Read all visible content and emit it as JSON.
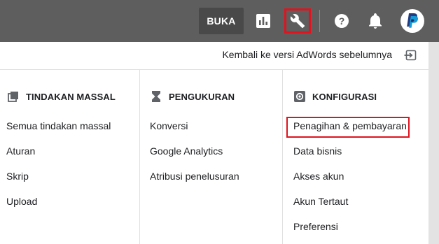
{
  "header": {
    "buka_label": "BUKA",
    "icons": [
      "reports-icon",
      "wrench-icon",
      "help-icon",
      "bell-icon",
      "paypal-avatar"
    ],
    "highlight_color": "#e0131f"
  },
  "panel": {
    "kembali_text": "Kembali ke versi AdWords sebelumnya",
    "columns": [
      {
        "heading": "TINDAKAN MASSAL",
        "icon": "bulk-actions-icon",
        "items": [
          "Semua tindakan massal",
          "Aturan",
          "Skrip",
          "Upload"
        ]
      },
      {
        "heading": "PENGUKURAN",
        "icon": "hourglass-icon",
        "items": [
          "Konversi",
          "Google Analytics",
          "Atribusi penelusuran"
        ]
      },
      {
        "heading": "KONFIGURASI",
        "icon": "settings-icon",
        "items": [
          "Penagihan & pembayaran",
          "Data bisnis",
          "Akses akun",
          "Akun Tertaut",
          "Preferensi"
        ]
      }
    ]
  }
}
